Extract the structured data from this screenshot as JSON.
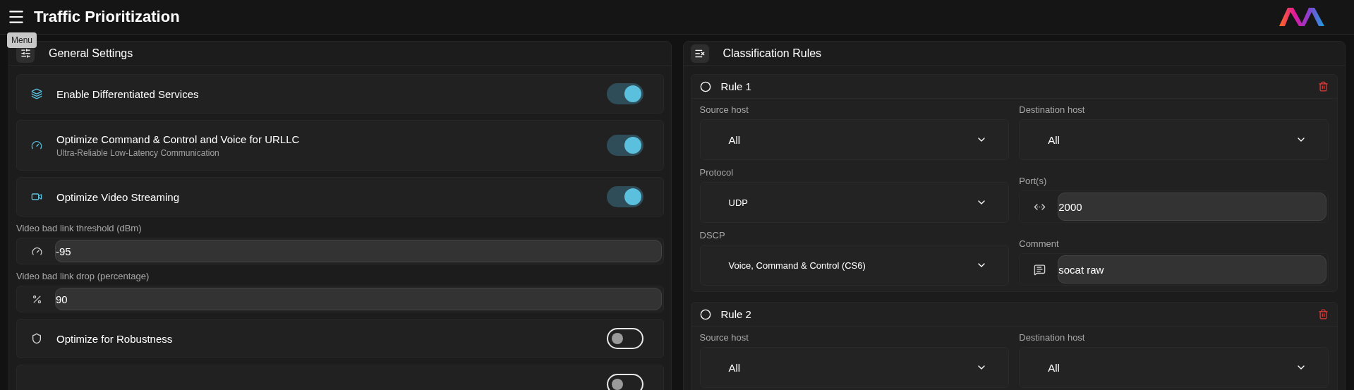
{
  "header": {
    "title": "Traffic Prioritization",
    "tooltip": "Menu"
  },
  "general_settings": {
    "title": "General Settings",
    "items": [
      {
        "kind": "toggle",
        "label": "Enable Differentiated Services",
        "on": true
      },
      {
        "kind": "toggle",
        "label": "Optimize Command & Control and Voice for URLLC",
        "sublabel": "Ultra-Reliable Low-Latency Communication",
        "on": true
      },
      {
        "kind": "toggle",
        "label": "Optimize Video Streaming",
        "on": true
      },
      {
        "kind": "input",
        "label": "Video bad link threshold (dBm)",
        "value": "-95"
      },
      {
        "kind": "input",
        "label": "Video bad link drop (percentage)",
        "value": "90"
      },
      {
        "kind": "toggle",
        "label": "Optimize for Robustness",
        "on": false
      },
      {
        "kind": "toggle",
        "on": false
      }
    ]
  },
  "classification_rules": {
    "title": "Classification Rules",
    "rules": [
      {
        "title": "Rule 1",
        "fields": [
          {
            "kind": "select",
            "label": "Source host",
            "value": "All"
          },
          {
            "kind": "select",
            "label": "Destination host",
            "value": "All"
          },
          {
            "kind": "select",
            "label": "Protocol",
            "value": "UDP"
          },
          {
            "kind": "input",
            "label": "Port(s)",
            "value": "2000"
          },
          {
            "kind": "select",
            "label": "DSCP",
            "value": "Voice, Command & Control (CS6)"
          },
          {
            "kind": "input",
            "label": "Comment",
            "value": "socat raw"
          }
        ]
      },
      {
        "title": "Rule 2",
        "fields": [
          {
            "kind": "select",
            "label": "Source host",
            "value": "All"
          },
          {
            "kind": "select",
            "label": "Destination host",
            "value": "All"
          }
        ]
      }
    ]
  }
}
